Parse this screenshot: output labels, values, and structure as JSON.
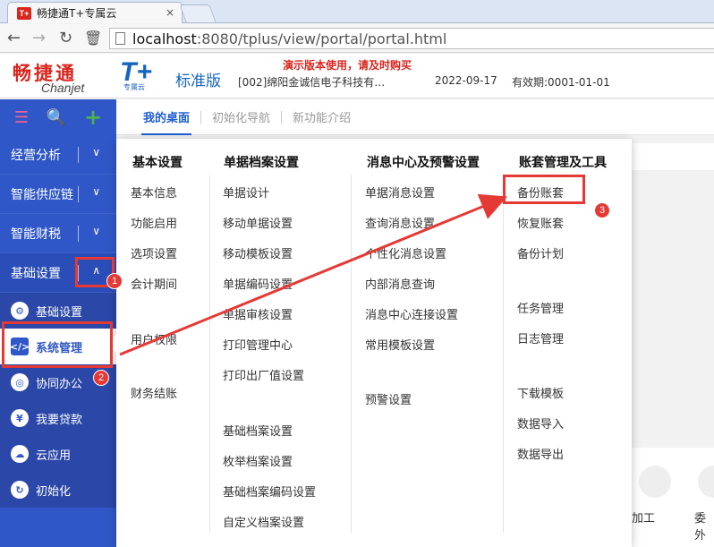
{
  "browser": {
    "tab_title": "畅捷通T+专属云",
    "favicon_text": "T+",
    "close_glyph": "×",
    "url_host": "localhost",
    "url_rest": ":8080/tplus/view/portal/portal.html"
  },
  "header": {
    "logo_cn": "畅捷通",
    "logo_en": "Chanjet",
    "product": "T+",
    "product_sub": "专属云",
    "edition": "标准版",
    "demo_notice": "演示版本使用，请及时购买",
    "company": "[002]绵阳金诚信电子科技有…",
    "date": "2022-09-17",
    "valid_until": "有效期:0001-01-01"
  },
  "sidebar": {
    "items": [
      {
        "label": "经营分析"
      },
      {
        "label": "智能供应链"
      },
      {
        "label": "智能财税"
      },
      {
        "label": "基础设置"
      }
    ],
    "sub_items": [
      {
        "label": "基础设置",
        "icon": "⚙"
      },
      {
        "label": "系统管理",
        "icon": "</>"
      },
      {
        "label": "协同办公",
        "icon": "◎"
      },
      {
        "label": "我要贷款",
        "icon": "¥"
      },
      {
        "label": "云应用",
        "icon": "☁"
      },
      {
        "label": "初始化",
        "icon": "↻"
      }
    ]
  },
  "tabs": [
    {
      "label": "我的桌面"
    },
    {
      "label": "初始化导航"
    },
    {
      "label": "新功能介绍"
    }
  ],
  "menu": {
    "columns": [
      {
        "header": "基本设置",
        "items": [
          "基本信息",
          "功能启用",
          "选项设置",
          "会计期间",
          "用户权限",
          "财务结账"
        ]
      },
      {
        "header": "单据档案设置",
        "items": [
          "单据设计",
          "移动单据设置",
          "移动模板设置",
          "单据编码设置",
          "单据审核设置",
          "打印管理中心",
          "打印出厂值设置",
          "基础档案设置",
          "枚举档案设置",
          "基础档案编码设置",
          "自定义档案设置"
        ]
      },
      {
        "header": "消息中心及预警设置",
        "items": [
          "单据消息设置",
          "查询消息设置",
          "个性化消息设置",
          "内部消息查询",
          "消息中心连接设置",
          "常用模板设置",
          "预警设置"
        ]
      },
      {
        "header": "账套管理及工具",
        "items": [
          "备份账套",
          "恢复账套",
          "备份计划",
          "任务管理",
          "日志管理",
          "下载模板",
          "数据导入",
          "数据导出"
        ]
      }
    ]
  },
  "background": {
    "label_1": "加工",
    "label_2": "委外"
  },
  "annotations": {
    "badge_1": "1",
    "badge_2": "2",
    "badge_3": "3",
    "color": "#e53935"
  }
}
